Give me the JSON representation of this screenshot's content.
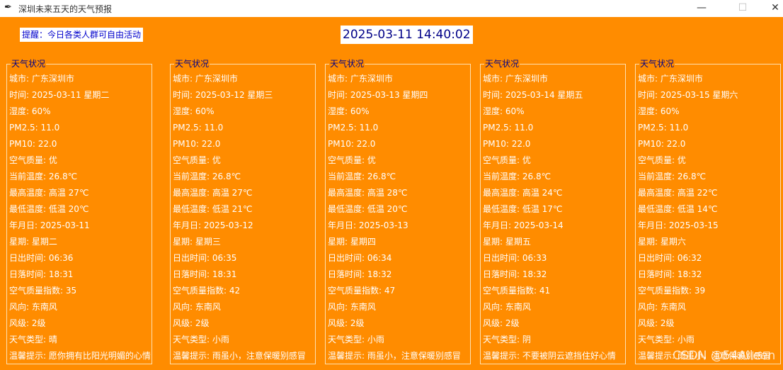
{
  "window": {
    "title": "深圳未来五天的天气预报",
    "app_icon": "feather-icon",
    "controls": {
      "minimize": "—",
      "maximize": "☐",
      "close": "✕"
    }
  },
  "header": {
    "reminder": "提醒：今日各类人群可自由活动",
    "datetime": "2025-03-11 14:40:02"
  },
  "cards": [
    {
      "title": "天气状况",
      "fields": [
        "城市: 广东深圳市",
        "时间: 2025-03-11 星期二",
        "湿度: 60%",
        "PM2.5: 11.0",
        "PM10: 22.0",
        "空气质量: 优",
        "当前温度: 26.8℃",
        "最高温度: 高温 27℃",
        "最低温度: 低温 20℃",
        "年月日: 2025-03-11",
        "星期: 星期二",
        "日出时间: 06:36",
        "日落时间: 18:31",
        "空气质量指数: 35",
        "风向: 东南风",
        "风级: 2级",
        "天气类型: 晴",
        "温馨提示: 愿你拥有比阳光明媚的心情"
      ]
    },
    {
      "title": "天气状况",
      "fields": [
        "城市: 广东深圳市",
        "时间: 2025-03-12 星期三",
        "湿度: 60%",
        "PM2.5: 11.0",
        "PM10: 22.0",
        "空气质量: 优",
        "当前温度: 26.8℃",
        "最高温度: 高温 27℃",
        "最低温度: 低温 21℃",
        "年月日: 2025-03-12",
        "星期: 星期三",
        "日出时间: 06:35",
        "日落时间: 18:31",
        "空气质量指数: 42",
        "风向: 东南风",
        "风级: 2级",
        "天气类型: 小雨",
        "温馨提示: 雨虽小，注意保暖别感冒"
      ]
    },
    {
      "title": "天气状况",
      "fields": [
        "城市: 广东深圳市",
        "时间: 2025-03-13 星期四",
        "湿度: 60%",
        "PM2.5: 11.0",
        "PM10: 22.0",
        "空气质量: 优",
        "当前温度: 26.8℃",
        "最高温度: 高温 28℃",
        "最低温度: 低温 20℃",
        "年月日: 2025-03-13",
        "星期: 星期四",
        "日出时间: 06:34",
        "日落时间: 18:32",
        "空气质量指数: 47",
        "风向: 东南风",
        "风级: 2级",
        "天气类型: 小雨",
        "温馨提示: 雨虽小，注意保暖别感冒"
      ]
    },
    {
      "title": "天气状况",
      "fields": [
        "城市: 广东深圳市",
        "时间: 2025-03-14 星期五",
        "湿度: 60%",
        "PM2.5: 11.0",
        "PM10: 22.0",
        "空气质量: 优",
        "当前温度: 26.8℃",
        "最高温度: 高温 24℃",
        "最低温度: 低温 17℃",
        "年月日: 2025-03-14",
        "星期: 星期五",
        "日出时间: 06:33",
        "日落时间: 18:32",
        "空气质量指数: 41",
        "风向: 东南风",
        "风级: 2级",
        "天气类型: 阴",
        "温馨提示: 不要被阴云遮挡住好心情"
      ]
    },
    {
      "title": "天气状况",
      "fields": [
        "城市: 广东深圳市",
        "时间: 2025-03-15 星期六",
        "湿度: 60%",
        "PM2.5: 11.0",
        "PM10: 22.0",
        "空气质量: 优",
        "当前温度: 26.8℃",
        "最高温度: 高温 22℃",
        "最低温度: 低温 14℃",
        "年月日: 2025-03-15",
        "星期: 星期六",
        "日出时间: 06:32",
        "日落时间: 18:32",
        "空气质量指数: 39",
        "风向: 东南风",
        "风级: 2级",
        "天气类型: 小雨",
        "温馨提示: 雨虽小，注意保暖别感冒"
      ]
    }
  ],
  "watermark": "CSDN @54Aileen",
  "colors": {
    "background": "#ff8c00",
    "reminder_text": "#0000cc",
    "clock_text": "#000088",
    "card_title": "#000088",
    "field_text": "#ffffff"
  }
}
